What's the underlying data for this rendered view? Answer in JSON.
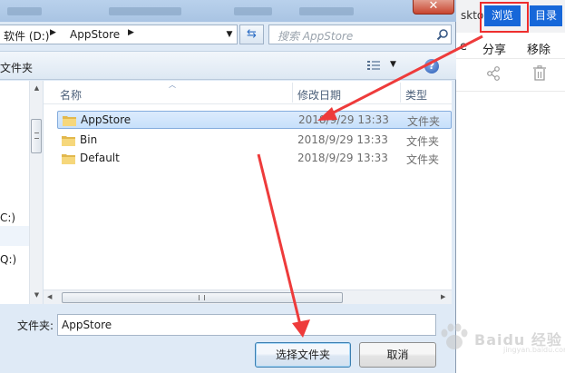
{
  "dialog": {
    "address": {
      "crumb1": "软件 (D:)",
      "crumb2": "AppStore"
    },
    "search": {
      "placeholder": "搜索 AppStore"
    },
    "toolbar": {
      "new_folder": "文件夹"
    },
    "nav": {
      "items": [
        "C:)",
        "Q:)"
      ]
    },
    "columns": {
      "name": "名称",
      "date": "修改日期",
      "type": "类型"
    },
    "files": [
      {
        "name": "AppStore",
        "date": "2018/9/29 13:33",
        "type": "文件夹"
      },
      {
        "name": "Bin",
        "date": "2018/9/29 13:33",
        "type": "文件夹"
      },
      {
        "name": "Default",
        "date": "2018/9/29 13:33",
        "type": "文件夹"
      }
    ],
    "folder_label": "文件夹:",
    "folder_value": "AppStore",
    "ok_label": "选择文件夹",
    "cancel_label": "取消"
  },
  "right_panel": {
    "partial_text": "skto",
    "browse_label": "浏览",
    "catalog_label": "目录",
    "share_label": "分享",
    "remove_label": "移除",
    "dot": "e"
  },
  "watermark": {
    "text": "Baidu 经验",
    "sub": "jingyan.baidu.com"
  },
  "colors": {
    "accent": "#1667d9",
    "highlight": "#ee2e2e",
    "selection": "#c7e0fb"
  }
}
